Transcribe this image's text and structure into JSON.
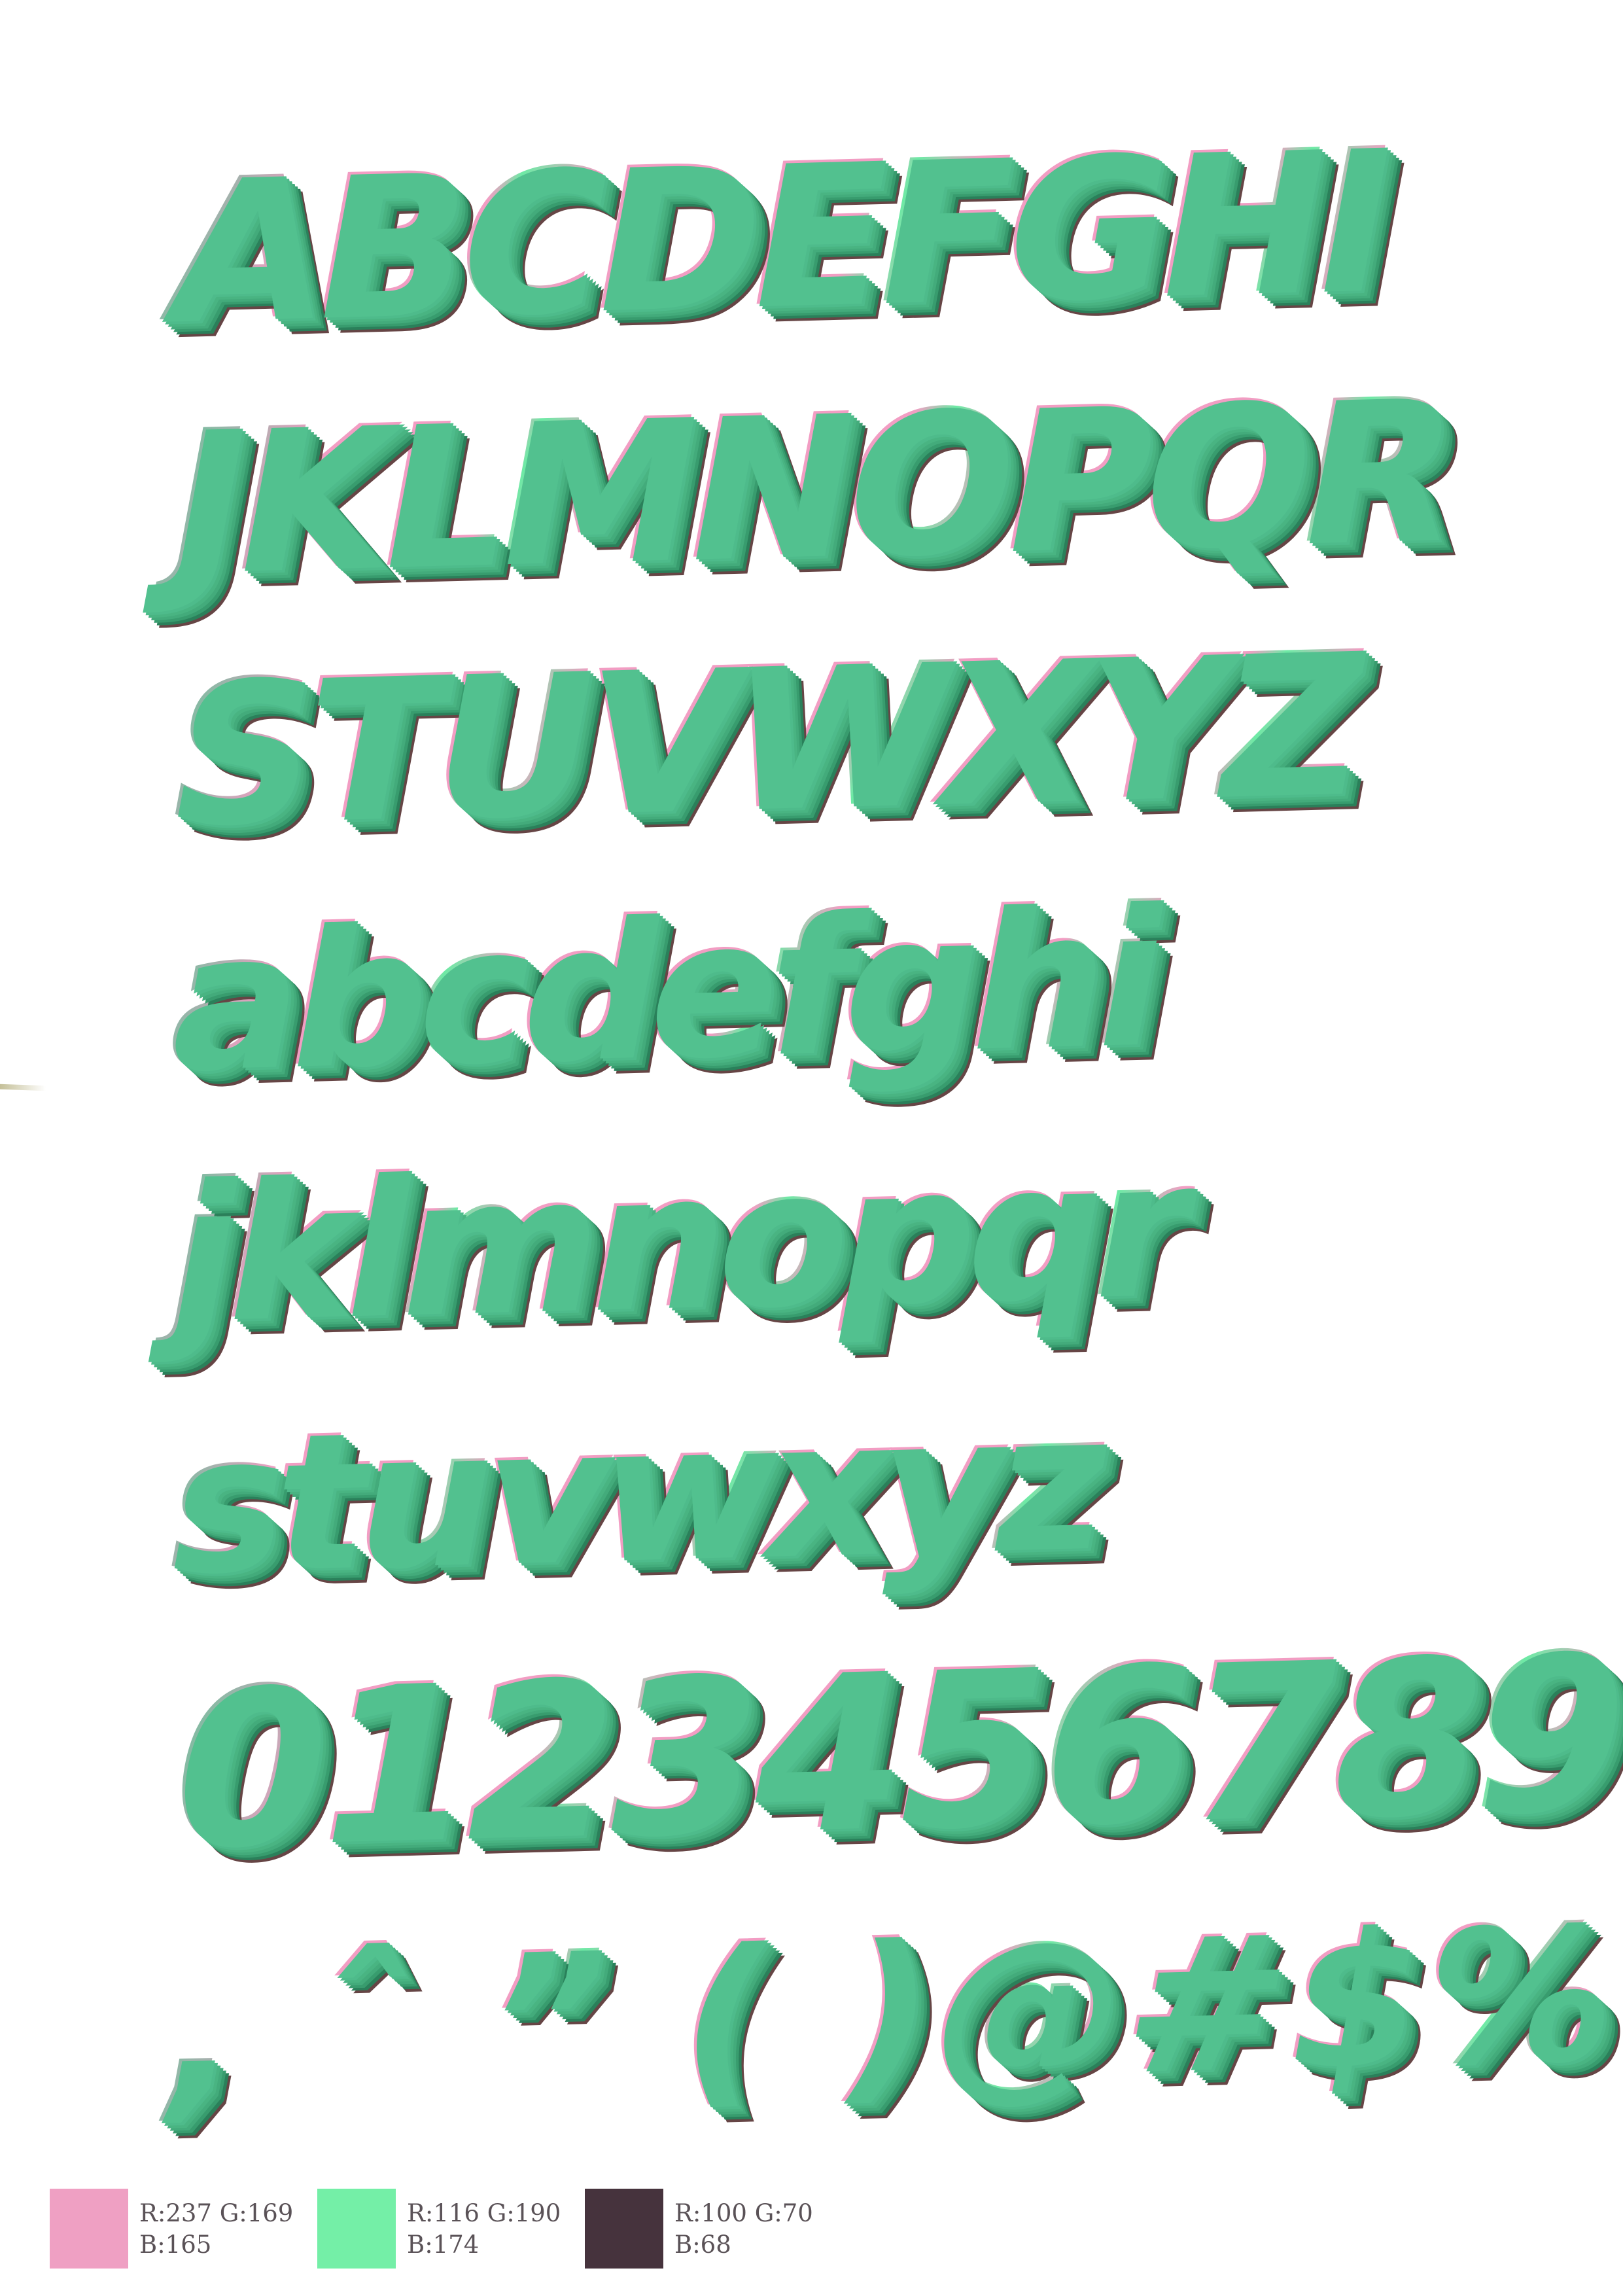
{
  "glyph_rows": [
    {
      "text": "ABCDEFGHI",
      "kind": "upper"
    },
    {
      "text": "JKLMNOPQR",
      "kind": "upper"
    },
    {
      "text": "STUVWXYZ",
      "kind": "upper"
    },
    {
      "text": "abcdefghi",
      "kind": "lower"
    },
    {
      "text": "jklmnopqr",
      "kind": "lower"
    },
    {
      "text": "stuvwxyz",
      "kind": "lower"
    },
    {
      "text": "0123456789",
      "kind": "digits"
    },
    {
      "text": ", ˆ ” ( )@#$%",
      "kind": "symbols"
    }
  ],
  "colors": {
    "pink": "#EDA9A5",
    "green": "#74BEAE",
    "dark": "#644644"
  },
  "palette": [
    {
      "line1": "R:237 G:169",
      "line2": "B:165",
      "color": "#EFA0C3"
    },
    {
      "line1": "R:116 G:190",
      "line2": "B:174",
      "color": "#74EFA7"
    },
    {
      "line1": "R:100 G:70",
      "line2": "B:68",
      "color": "#46333D"
    }
  ]
}
